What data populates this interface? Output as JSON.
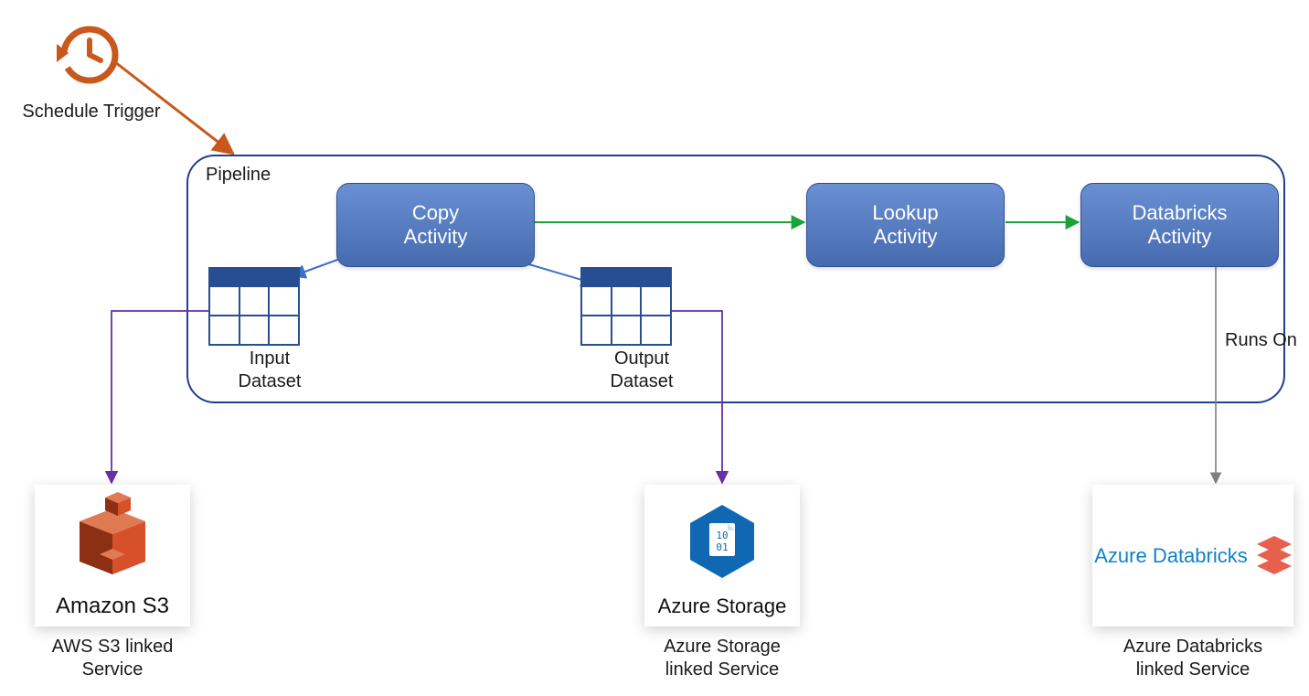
{
  "trigger": {
    "label": "Schedule Trigger"
  },
  "pipeline": {
    "title": "Pipeline",
    "activities": {
      "copy": {
        "label": "Copy\nActivity"
      },
      "lookup": {
        "label": "Lookup\nActivity"
      },
      "databricks": {
        "label": "Databricks\nActivity"
      }
    },
    "datasets": {
      "input": {
        "label": "Input\nDataset"
      },
      "output": {
        "label": "Output\nDataset"
      }
    },
    "edges": {
      "runs_on": "Runs On"
    }
  },
  "services": {
    "aws_s3": {
      "card_title": "Amazon S3",
      "label": "AWS S3 linked\nService"
    },
    "azure_storage": {
      "card_title": "Azure Storage",
      "label": "Azure Storage\nlinked Service"
    },
    "azure_databricks": {
      "card_title": "Azure Databricks",
      "label": "Azure Databricks\nlinked Service"
    }
  },
  "colors": {
    "trigger_arrow": "#c8581c",
    "pipeline_border": "#1f3f8f",
    "activity_fill": "#5a7ec4",
    "success_arrow": "#1aa13a",
    "dataset_arrow": "#3f6fc4",
    "service_arrow": "#6a2fa8",
    "runs_on_arrow": "#7f7f7f",
    "aws_orange": "#b6421a"
  }
}
